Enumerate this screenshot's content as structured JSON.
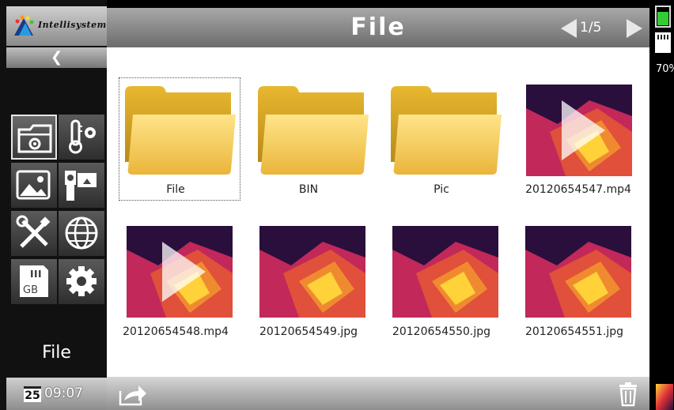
{
  "logo": {
    "text": "Intellisystem"
  },
  "sidebar": {
    "collapse_icon": "chevron-left-icon",
    "title": "File",
    "buttons": [
      {
        "name": "file-folder-settings-icon",
        "selected": true
      },
      {
        "name": "thermometer-settings-icon",
        "selected": false
      },
      {
        "name": "image-gallery-icon",
        "selected": false
      },
      {
        "name": "video-camera-icon",
        "selected": false
      },
      {
        "name": "tools-icon",
        "selected": false
      },
      {
        "name": "globe-icon",
        "selected": false
      },
      {
        "name": "sd-card-icon",
        "selected": false
      },
      {
        "name": "gear-icon",
        "selected": false
      }
    ],
    "date_day": "25",
    "time": "09:07"
  },
  "header": {
    "title": "File",
    "page_indicator": "1/5"
  },
  "files": [
    {
      "label": "File",
      "type": "folder",
      "selected": true
    },
    {
      "label": "BIN",
      "type": "folder",
      "selected": false
    },
    {
      "label": "Pic",
      "type": "folder",
      "selected": false
    },
    {
      "label": "20120654547.mp4",
      "type": "video",
      "selected": false
    },
    {
      "label": "20120654548.mp4",
      "type": "video",
      "selected": false
    },
    {
      "label": "20120654549.jpg",
      "type": "image",
      "selected": false
    },
    {
      "label": "20120654550.jpg",
      "type": "image",
      "selected": false
    },
    {
      "label": "20120654551.jpg",
      "type": "image",
      "selected": false
    }
  ],
  "footer": {
    "share_icon": "share-icon",
    "delete_icon": "trash-icon"
  },
  "status": {
    "battery_text": "70%",
    "battery_level": 0.7
  },
  "colors": {
    "thermal_dark": "#2a0f3d",
    "thermal_mid": "#c2285a",
    "thermal_hot": "#ffd23a",
    "folder": "#f3c84a"
  }
}
